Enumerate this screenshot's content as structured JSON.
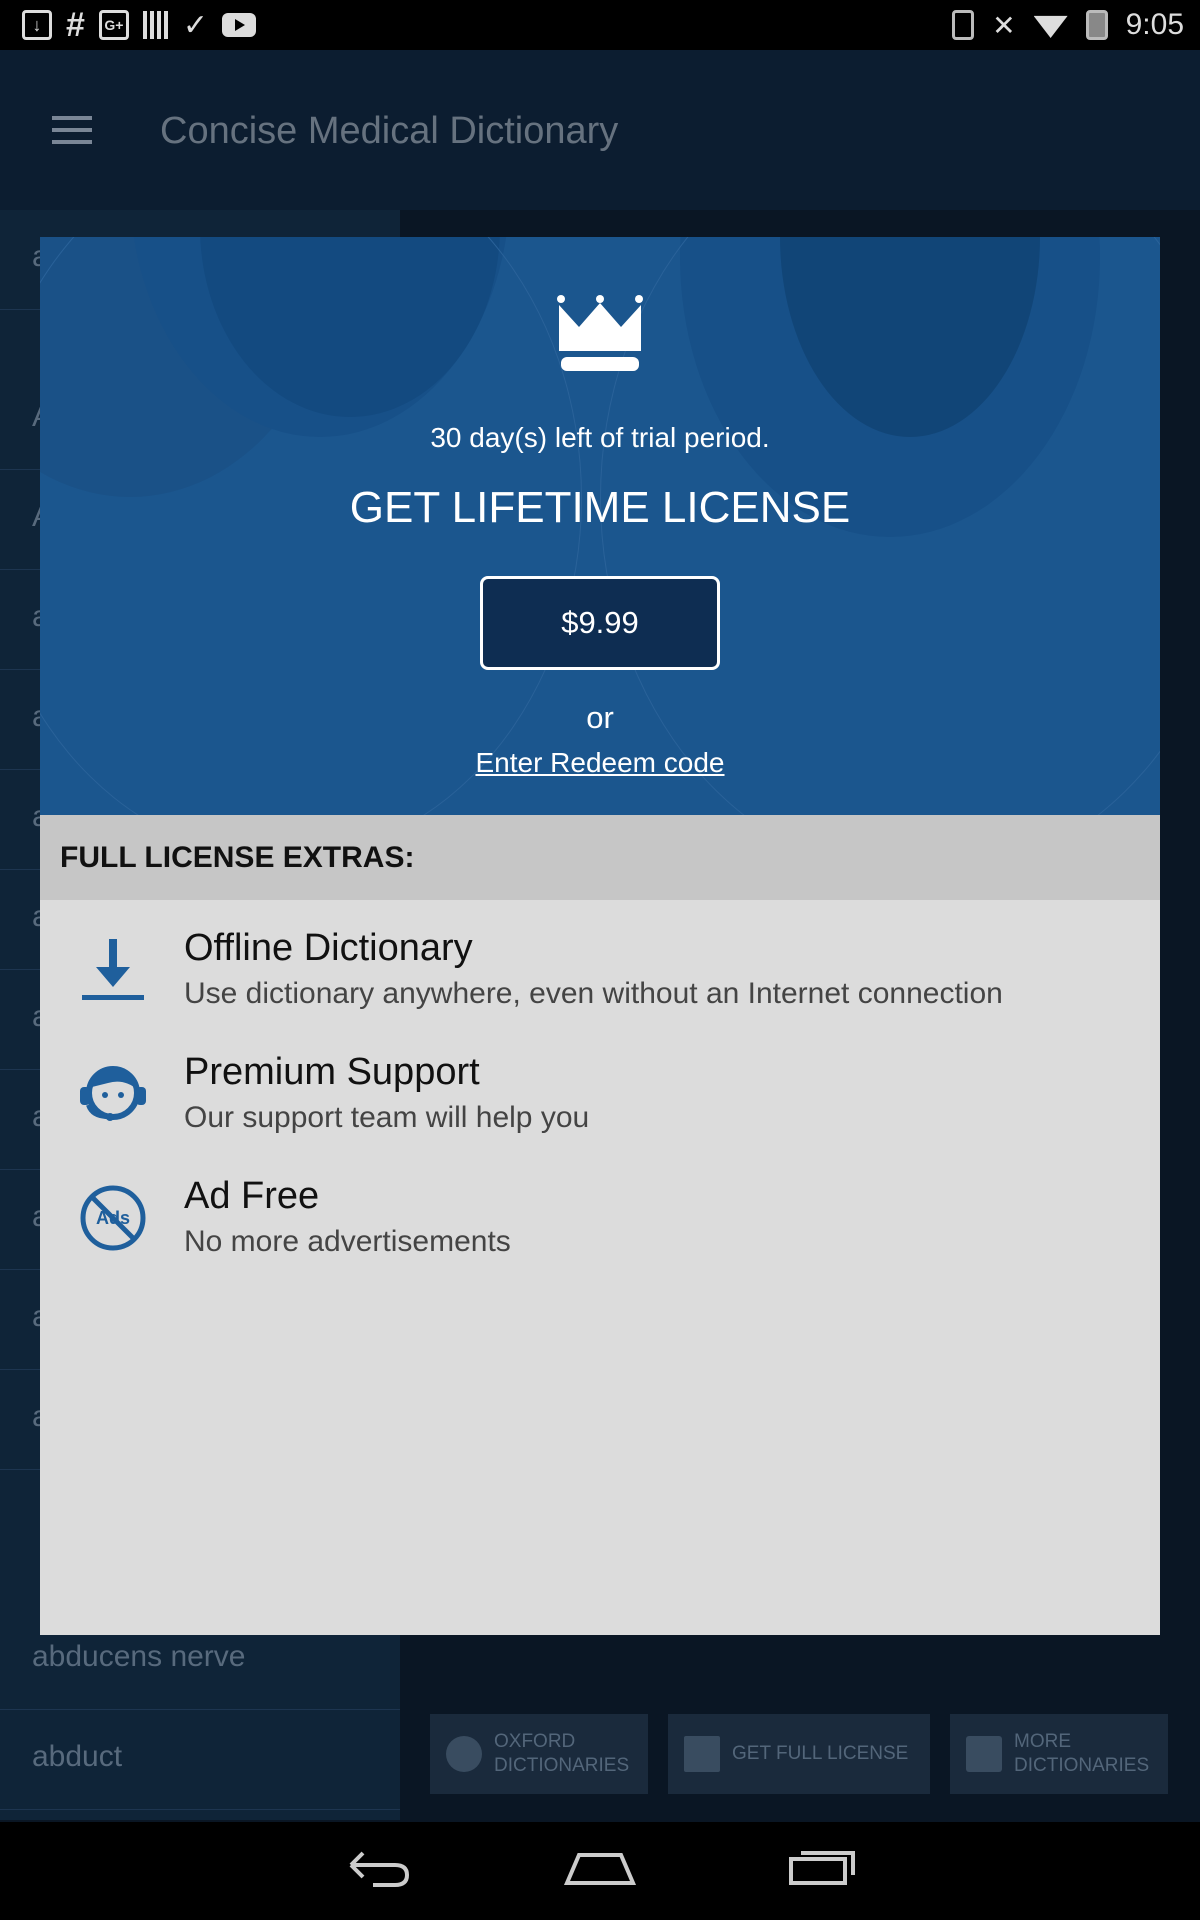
{
  "status_bar": {
    "time": "9:05",
    "left_icons": [
      "download-icon",
      "hashtag-icon",
      "google-plus-icon",
      "barcode-icon",
      "task-icon",
      "youtube-icon"
    ],
    "right_icons": [
      "bluetooth-icon",
      "mute-icon",
      "wifi-icon",
      "battery-icon"
    ]
  },
  "app_bar": {
    "title": "Concise Medical Dictionary"
  },
  "sidebar": {
    "items": [
      "a",
      "A",
      "A",
      "a",
      "a",
      "a",
      "a",
      "a",
      "a",
      "a",
      "a",
      "a",
      "abducens nerve",
      "abduct"
    ]
  },
  "bottom_buttons": [
    {
      "label": "OXFORD\nDICTIONARIES",
      "icon": "globe-icon"
    },
    {
      "label": "GET FULL LICENSE",
      "icon": "crown-icon"
    },
    {
      "label": "MORE\nDICTIONARIES",
      "icon": "bag-icon"
    }
  ],
  "dialog": {
    "trial_text": "30 day(s) left of trial period.",
    "title": "GET LIFETIME LICENSE",
    "price": "$9.99",
    "or_text": "or",
    "redeem_link": "Enter Redeem code",
    "extras_header": "FULL LICENSE EXTRAS:",
    "features": [
      {
        "title": "Offline Dictionary",
        "description": "Use dictionary anywhere, even without an Internet connection",
        "icon": "download-icon"
      },
      {
        "title": "Premium Support",
        "description": "Our support team will help you",
        "icon": "support-agent-icon"
      },
      {
        "title": "Ad Free",
        "description": "No more advertisements",
        "icon": "no-ads-icon"
      }
    ]
  },
  "colors": {
    "hero_blue": "#1b568e",
    "price_button": "#0e2d52",
    "dialog_body": "#dcdcdc",
    "extras_header": "#c6c6c6",
    "icon_blue": "#1f5f9c"
  }
}
